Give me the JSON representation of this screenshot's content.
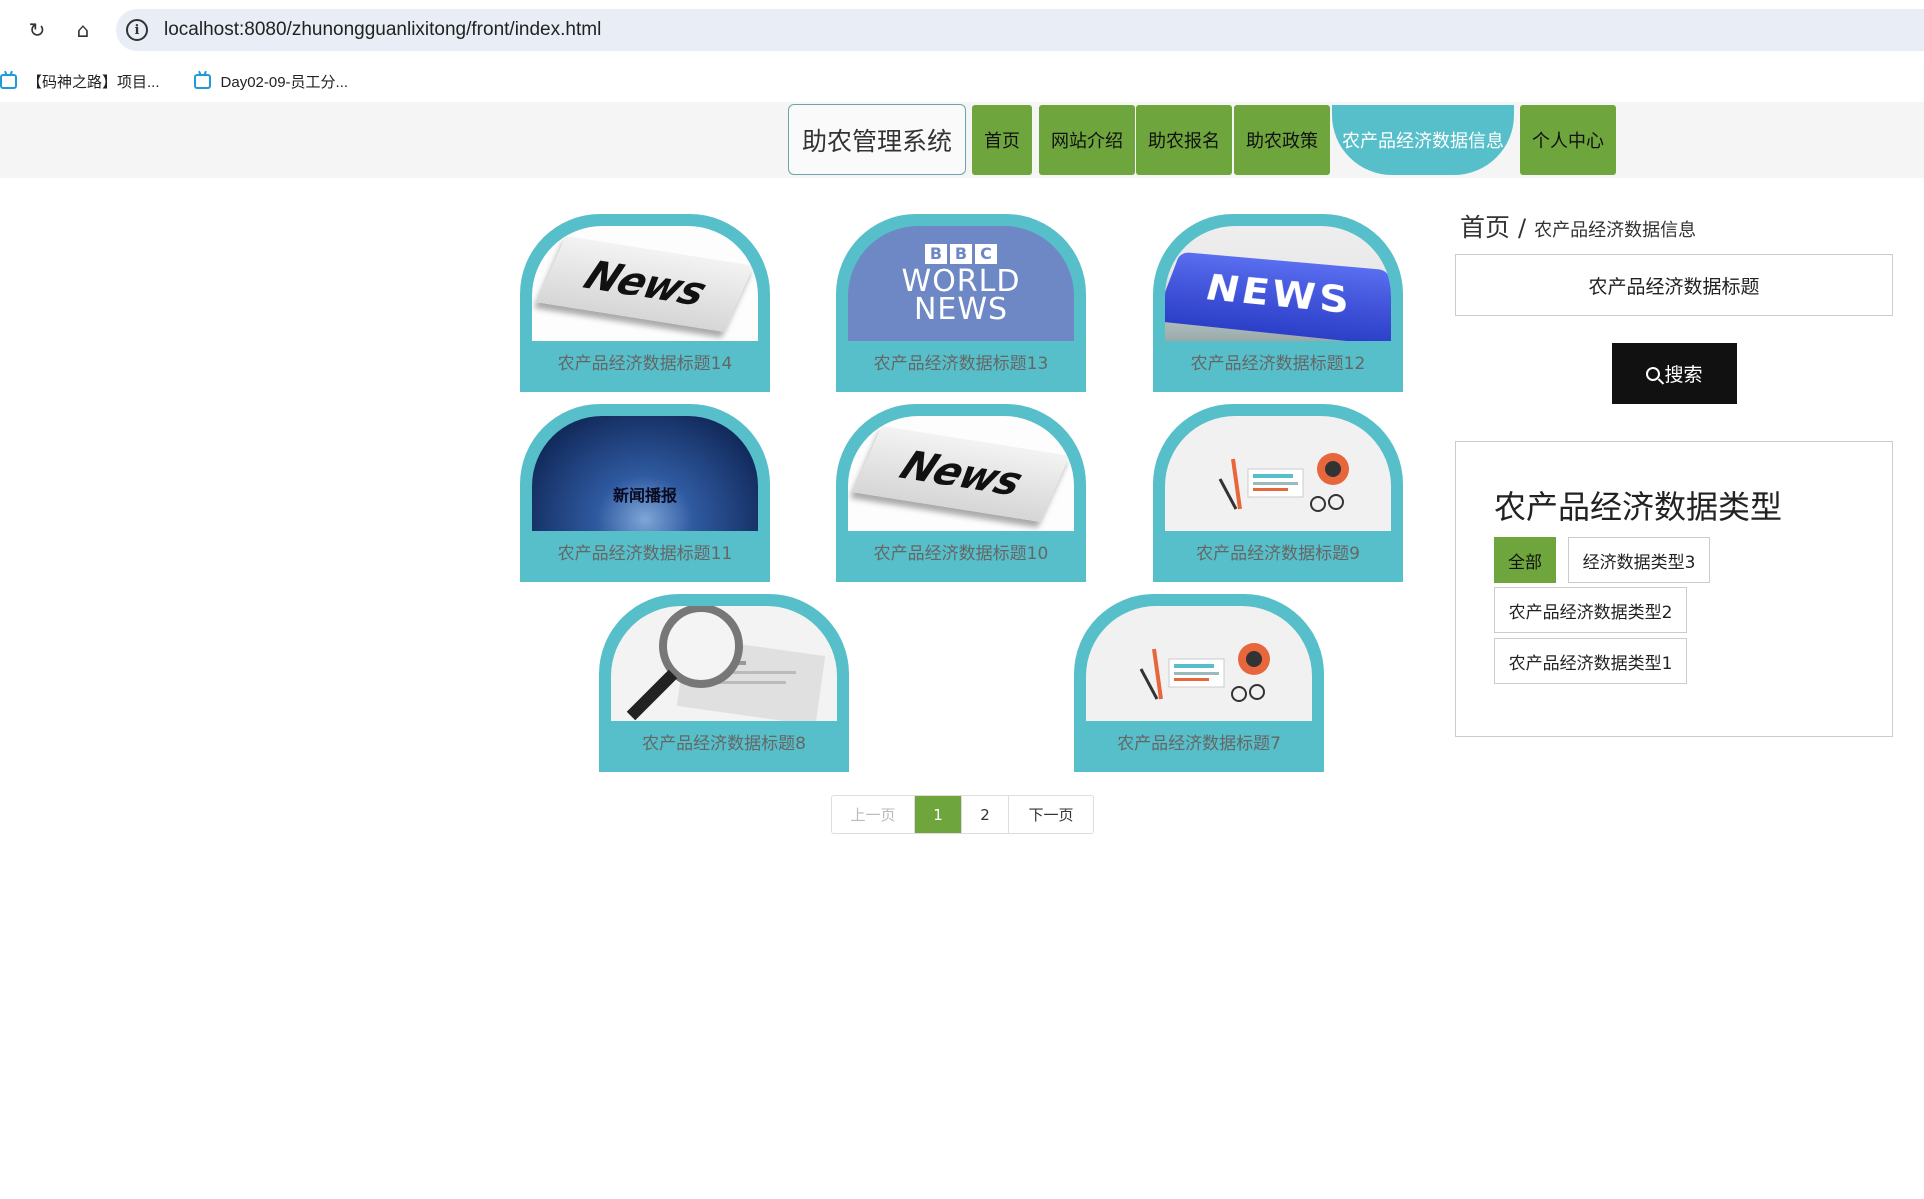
{
  "browser": {
    "url": "localhost:8080/zhunongguanlixitong/front/index.html",
    "bookmarks": [
      "【码神之路】项目...",
      "Day02-09-员工分..."
    ]
  },
  "nav": {
    "brand": "助农管理系统",
    "items": [
      "首页",
      "网站介绍",
      "助农报名",
      "助农政策",
      "农产品经济数据信息",
      "个人中心"
    ],
    "active": "农产品经济数据信息",
    "accent": "#6ea53c",
    "active_color": "#56bfc9"
  },
  "cards": [
    {
      "title": "农产品经济数据标题14",
      "image": "news-paper"
    },
    {
      "title": "农产品经济数据标题13",
      "image": "bbc-world-news",
      "bbc_letters": [
        "B",
        "B",
        "C"
      ],
      "bbc_text": "WORLD NEWS"
    },
    {
      "title": "农产品经济数据标题12",
      "image": "news-key",
      "key_text": "NEWS"
    },
    {
      "title": "农产品经济数据标题11",
      "image": "news-stage",
      "stage_text": "新闻播报"
    },
    {
      "title": "农产品经济数据标题10",
      "image": "news-paper"
    },
    {
      "title": "农产品经济数据标题9",
      "image": "news-flat"
    },
    {
      "title": "农产品经济数据标题8",
      "image": "news-magnifier"
    },
    {
      "title": "农产品经济数据标题7",
      "image": "news-flat"
    }
  ],
  "news_word": "News",
  "pager": {
    "prev": "上一页",
    "pages": [
      "1",
      "2"
    ],
    "current": "1",
    "next": "下一页"
  },
  "sidebar": {
    "breadcrumb_home": "首页",
    "breadcrumb_sep": "/",
    "breadcrumb_current": "农产品经济数据信息",
    "search_placeholder": "农产品经济数据标题",
    "search_button": "搜索",
    "type_title": "农产品经济数据类型",
    "types": [
      "全部",
      "经济数据类型3",
      "农产品经济数据类型2",
      "农产品经济数据类型1"
    ],
    "active_type": "全部"
  }
}
